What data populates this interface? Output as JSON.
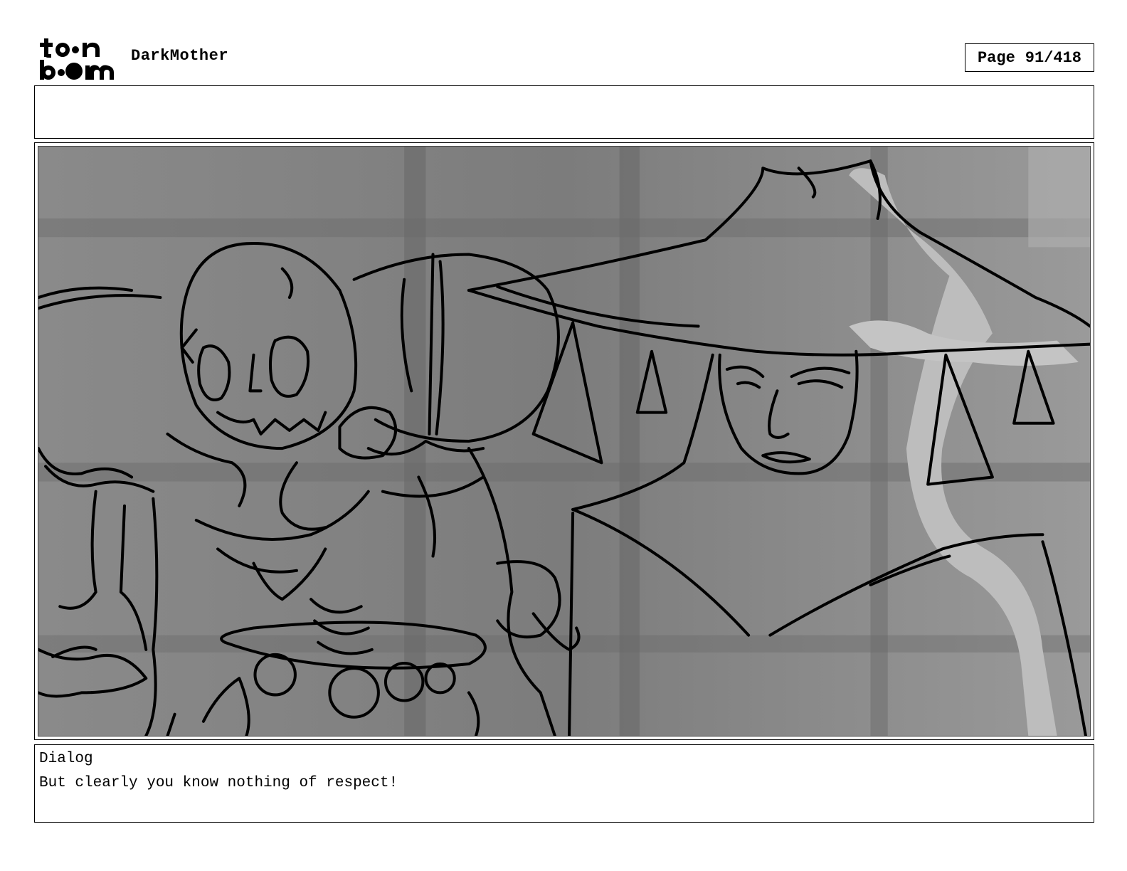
{
  "header": {
    "logo_text": "toonboom",
    "project_title": "DarkMother",
    "page_label": "Page",
    "page_number": "91/418"
  },
  "panel": {
    "image_description_icon": "storyboard-sketch"
  },
  "dialog": {
    "label": "Dialog",
    "text": "But clearly you know nothing of respect!"
  }
}
